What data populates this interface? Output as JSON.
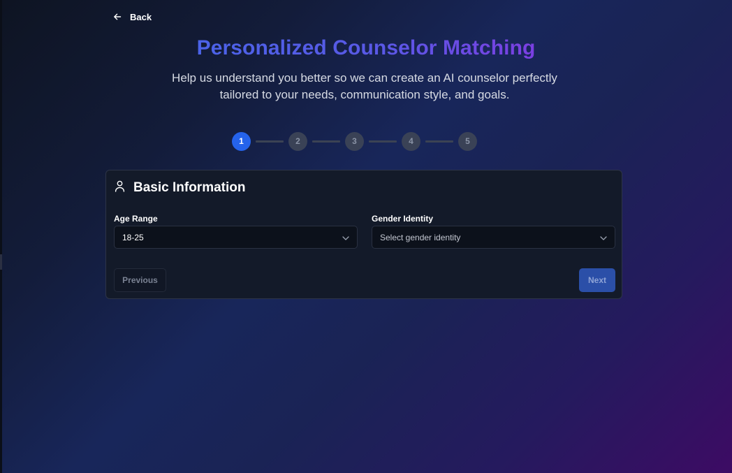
{
  "nav": {
    "back_label": "Back"
  },
  "header": {
    "title": "Personalized Counselor Matching",
    "subtitle": "Help us understand you better so we can create an AI counselor perfectly tailored to your needs, communication style, and goals."
  },
  "stepper": {
    "current_step": 1,
    "steps": [
      "1",
      "2",
      "3",
      "4",
      "5"
    ]
  },
  "form": {
    "section_title": "Basic Information",
    "section_icon": "user-icon",
    "age": {
      "label": "Age Range",
      "value": "18-25"
    },
    "gender": {
      "label": "Gender Identity",
      "placeholder": "Select gender identity"
    },
    "previous_label": "Previous",
    "next_label": "Next"
  },
  "colors": {
    "accent": "#2563eb",
    "title_gradient_start": "#4b63e8",
    "title_gradient_end": "#7b3fe2",
    "card_bg": "#131a29"
  }
}
